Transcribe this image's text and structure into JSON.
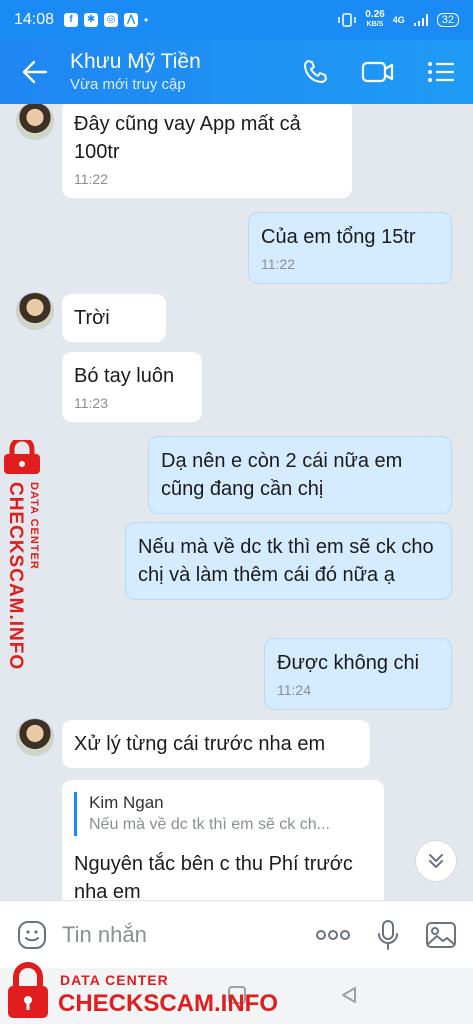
{
  "status_bar": {
    "time": "14:08",
    "app_icons": [
      "f",
      "✱",
      "◎",
      "⋀",
      "•"
    ],
    "speed_value": "0.26",
    "speed_unit": "KB/S",
    "network": "4G",
    "battery": "32"
  },
  "header": {
    "contact_name": "Khưu Mỹ Tiền",
    "contact_status": "Vừa mới truy cập",
    "accent": "#1a8bf4"
  },
  "messages": [
    {
      "side": "in",
      "text": "Đây cũng vay App mất cả 100tr",
      "time": "11:22"
    },
    {
      "side": "out",
      "text": "Của em tổng 15tr",
      "time": "11:22"
    },
    {
      "side": "in",
      "text": "Trời"
    },
    {
      "side": "in",
      "text": "Bó tay luôn",
      "time": "11:23"
    },
    {
      "side": "out",
      "text": "Dạ nên e còn 2 cái nữa em cũng đang cần chị"
    },
    {
      "side": "out",
      "text": "Nếu mà về dc tk thì em sẽ ck cho chị và làm thêm cái đó nữa ạ"
    },
    {
      "side": "out",
      "text": "Được không chi",
      "time": "11:24"
    },
    {
      "side": "in",
      "text": "Xử lý từng cái trước nha em"
    },
    {
      "side": "in",
      "quote_name": "Kim Ngan",
      "quote_text": "Nếu mà về dc tk thì em sẽ ck ch...",
      "text": "Nguyên tắc bên c thu Phí trước nha em"
    }
  ],
  "input": {
    "placeholder": "Tin nhắn"
  },
  "watermark": {
    "small": "DATA CENTER",
    "big": "CHECKSCAM.INFO",
    "color": "#e11d1d"
  }
}
